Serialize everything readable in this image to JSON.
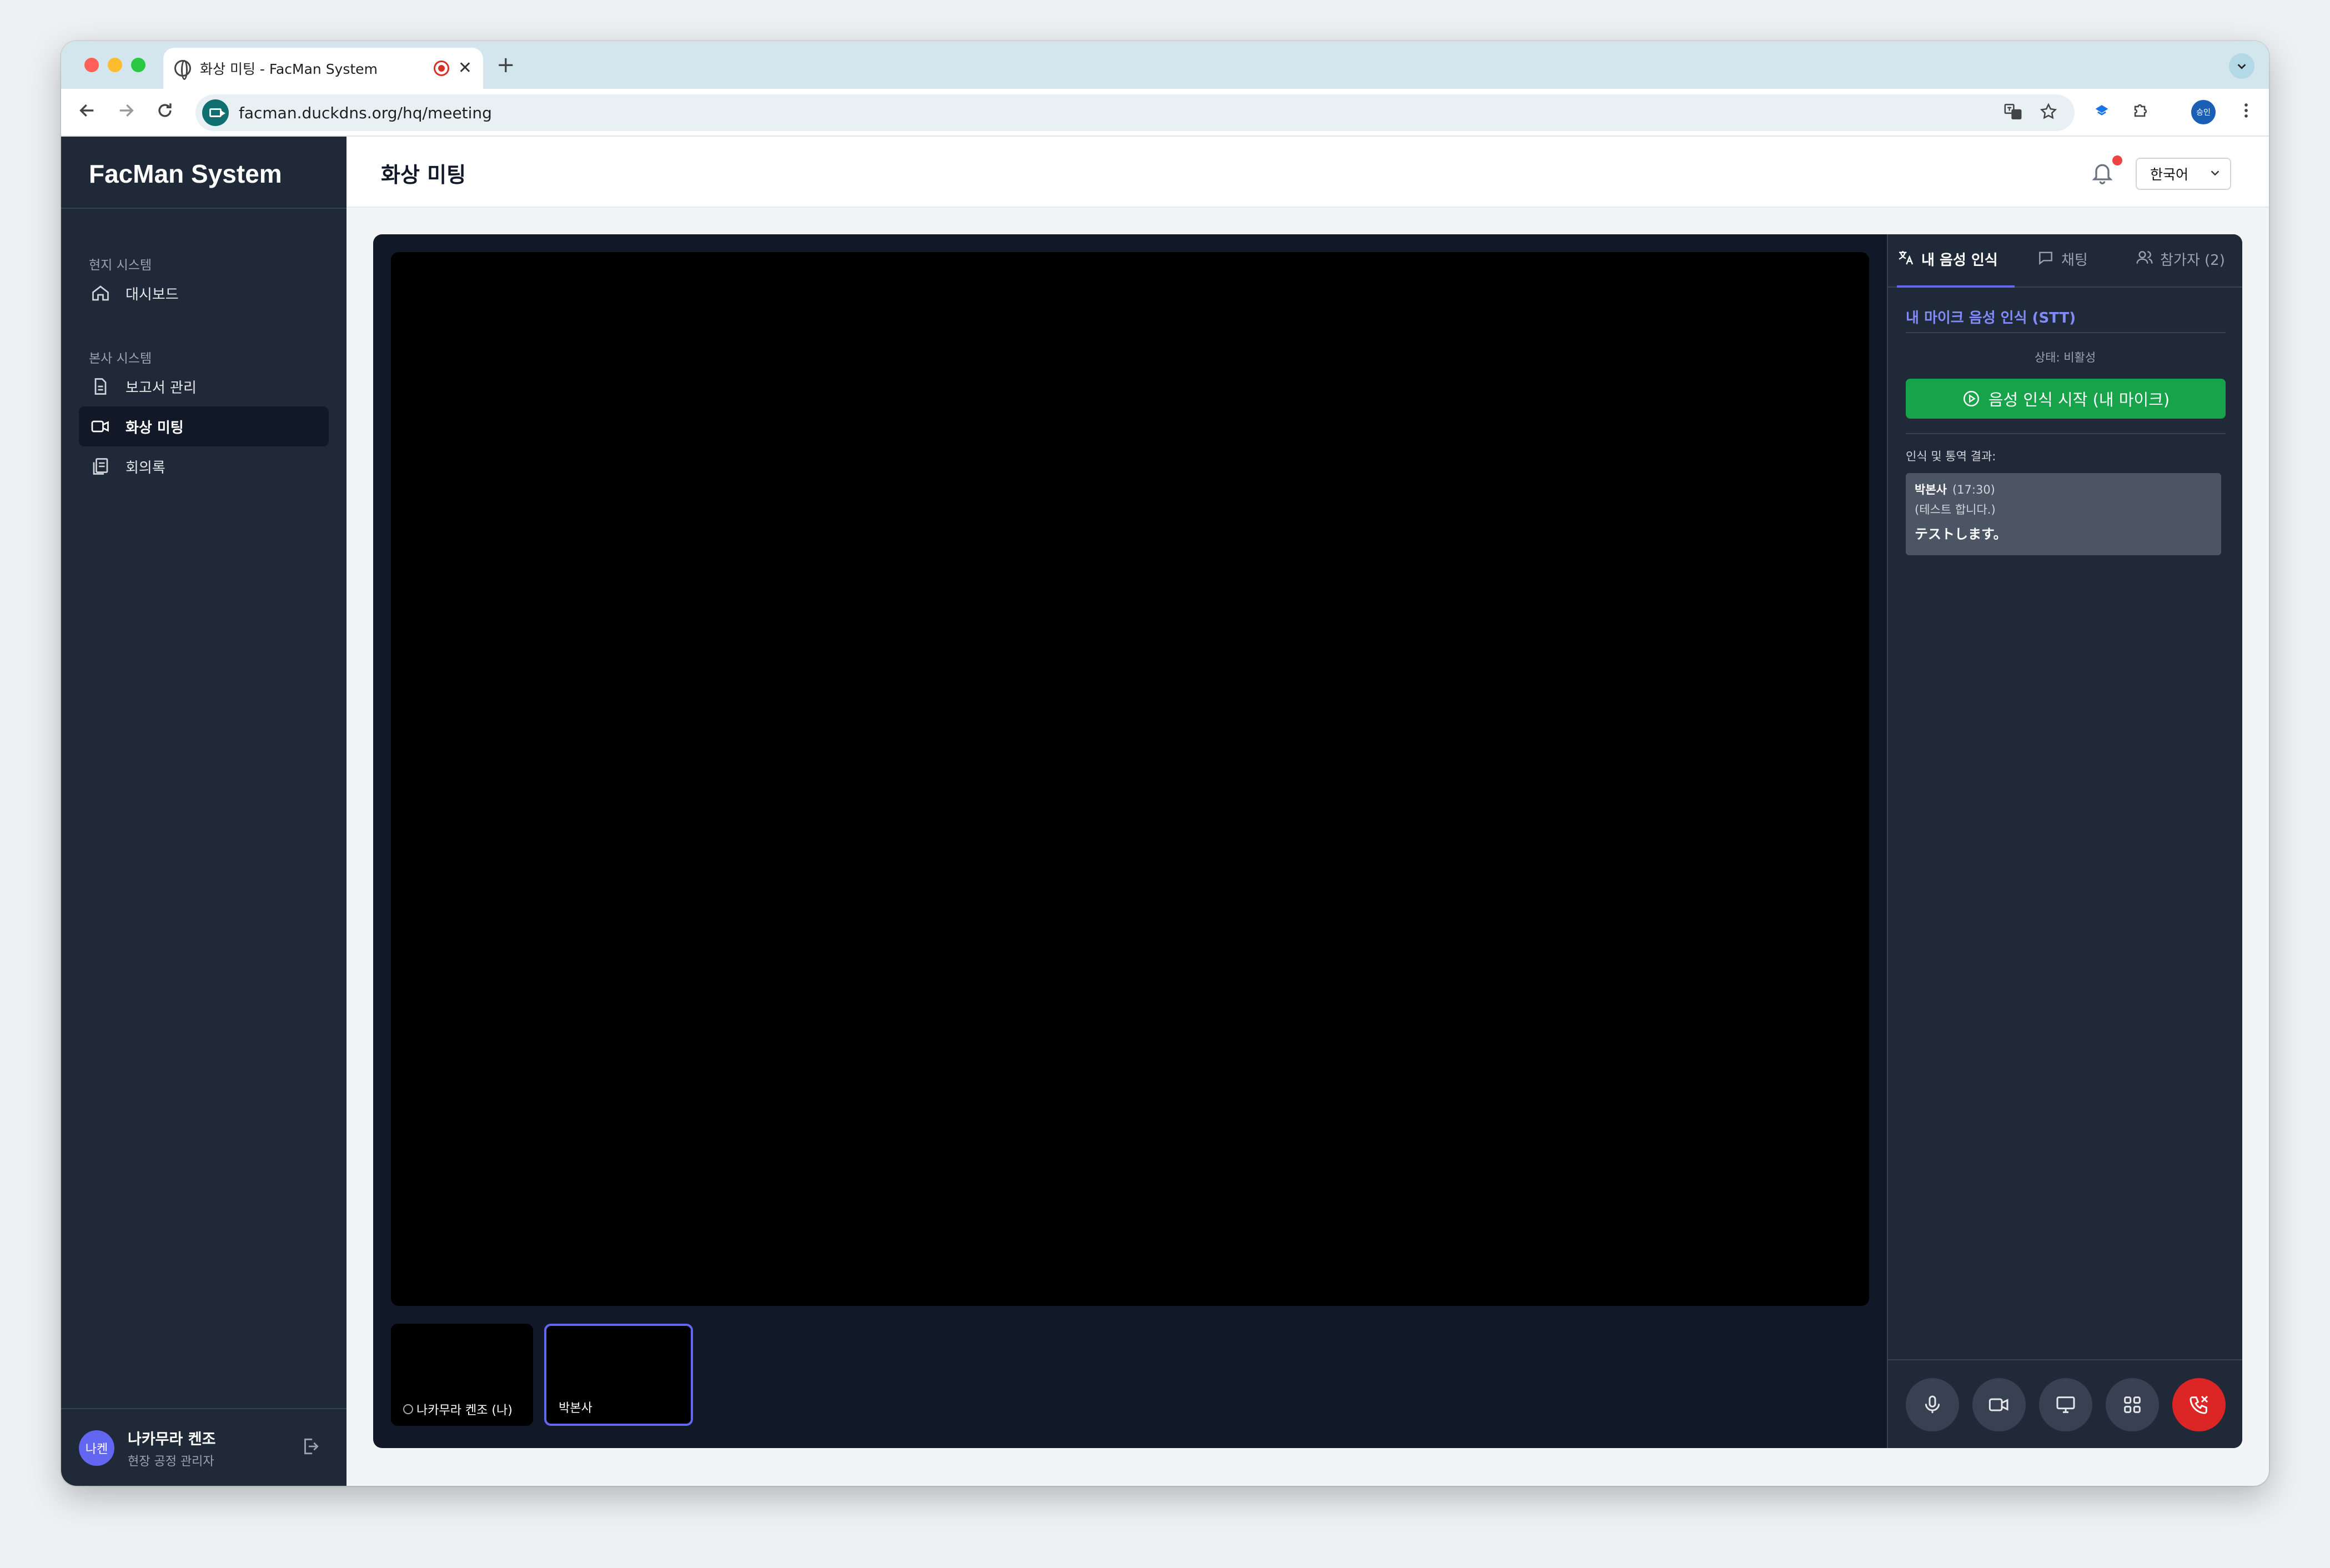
{
  "browser": {
    "tab_title": "화상 미팅 - FacMan System",
    "tab_close": "✕",
    "new_tab": "+",
    "url": "facman.duckdns.org/hq/meeting",
    "profile_label": "승인"
  },
  "sidebar": {
    "brand": "FacMan System",
    "sections": [
      {
        "label": "현지 시스템",
        "items": [
          {
            "label": "대시보드"
          }
        ]
      },
      {
        "label": "본사 시스템",
        "items": [
          {
            "label": "보고서 관리"
          },
          {
            "label": "화상 미팅"
          },
          {
            "label": "회의록"
          }
        ]
      }
    ],
    "active_item": "화상 미팅",
    "user": {
      "avatar": "나켄",
      "name": "나카무라 켄조",
      "role": "현장 공정 관리자"
    }
  },
  "header": {
    "title": "화상 미팅",
    "language": "한국어",
    "has_notification": true
  },
  "meeting": {
    "thumbnails": [
      {
        "label": "나카무라 켄조 (나)"
      },
      {
        "label": "박본사"
      }
    ]
  },
  "panel": {
    "tabs": [
      {
        "label": "내 음성 인식",
        "active": true
      },
      {
        "label": "채팅",
        "active": false
      },
      {
        "label": "참가자 (2)",
        "active": false
      }
    ],
    "stt_title": "내 마이크 음성 인식 (STT)",
    "status": "상태: 비활성",
    "start_button": "음성 인식 시작 (내 마이크)",
    "result_label": "인식 및 통역 결과:",
    "results": [
      {
        "speaker": "박본사",
        "time": "(17:30)",
        "original": "(테스트 합니다.)",
        "translation": "テストします。"
      }
    ]
  },
  "colors": {
    "sidebar_bg": "#1f2937",
    "meeting_bg": "#111827",
    "accent": "#6366f1",
    "start_green": "#16a34a",
    "end_red": "#dc2626"
  }
}
